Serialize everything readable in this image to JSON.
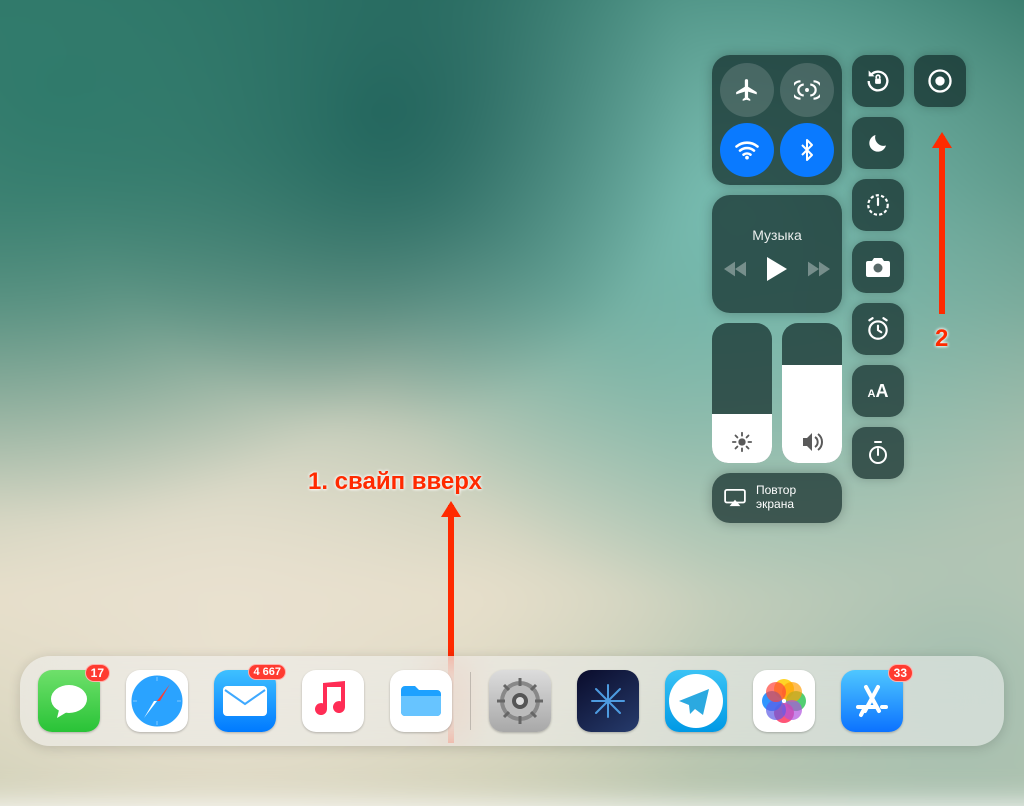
{
  "annotations": {
    "step1": "1. свайп вверх",
    "step2": "2"
  },
  "control_center": {
    "connectivity": {
      "airplane": {
        "on": false
      },
      "cellular": {
        "on": false
      },
      "wifi": {
        "on": true
      },
      "bluetooth": {
        "on": true
      }
    },
    "music": {
      "title": "Музыка"
    },
    "brightness_fill_pct": 35,
    "volume_fill_pct": 70,
    "screen_mirroring": "Повтор\nэкрана",
    "tiles": {
      "rotation_lock": "rotation-lock-icon",
      "screen_record": "screen-record-icon",
      "dnd": "moon-icon",
      "timer": "timer-icon",
      "camera": "camera-icon",
      "alarm": "alarm-icon",
      "textsize": "textsize-icon",
      "stopwatch": "stopwatch-icon"
    }
  },
  "dock": {
    "left": [
      {
        "name": "messages",
        "badge": "17"
      },
      {
        "name": "safari"
      },
      {
        "name": "mail",
        "badge": "4 667"
      },
      {
        "name": "music"
      },
      {
        "name": "files"
      }
    ],
    "right": [
      {
        "name": "settings"
      },
      {
        "name": "shazam"
      },
      {
        "name": "telegram"
      },
      {
        "name": "photos"
      },
      {
        "name": "appstore",
        "badge": "33"
      }
    ]
  }
}
